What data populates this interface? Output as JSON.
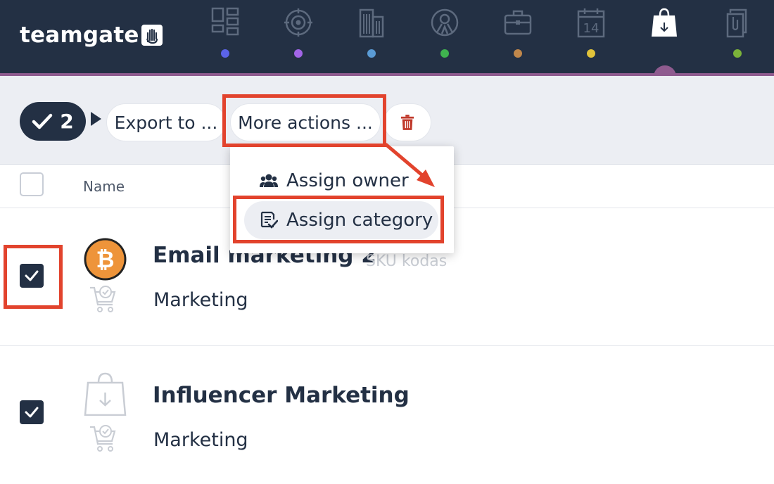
{
  "app": {
    "logo_text": "teamgate",
    "nav": [
      {
        "icon": "dashboard-icon",
        "dot_color": "#5b63e8"
      },
      {
        "icon": "target-icon",
        "dot_color": "#a265e8"
      },
      {
        "icon": "companies-icon",
        "dot_color": "#5a9bd5"
      },
      {
        "icon": "people-icon",
        "dot_color": "#3fb34f"
      },
      {
        "icon": "briefcase-icon",
        "dot_color": "#c0874b"
      },
      {
        "icon": "calendar-icon",
        "dot_color": "#e1c33a",
        "calendar_day": "14"
      },
      {
        "icon": "products-icon",
        "dot_color": "#8f5b8f",
        "active": true
      },
      {
        "icon": "documents-icon",
        "dot_color": "#7bb33a"
      }
    ],
    "accent_color": "#8f5b8f"
  },
  "toolbar": {
    "selected_count": "2",
    "export_label": "Export to ...",
    "more_actions_label": "More actions ...",
    "delete_icon": "trash-icon"
  },
  "dropdown": {
    "items": [
      {
        "label": "Assign owner",
        "icon": "users-icon"
      },
      {
        "label": "Assign category",
        "icon": "category-icon",
        "hovered": true
      }
    ]
  },
  "table": {
    "header_name": "Name",
    "rows": [
      {
        "title": "Email marketing 2",
        "sku": "SKU kodas",
        "category": "Marketing",
        "checked": true,
        "avatar": "bitcoin-icon"
      },
      {
        "title": "Influencer Marketing",
        "category": "Marketing",
        "checked": true,
        "avatar": "shopping-bag-icon"
      }
    ]
  },
  "annotation_color": "#e2432d"
}
